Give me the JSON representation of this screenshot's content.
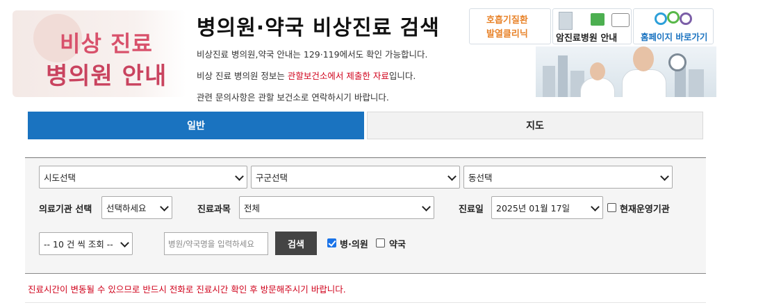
{
  "logo": {
    "line1": "비상 진료",
    "line2": "병의원 안내"
  },
  "title": "병의원·약국 비상진료 검색",
  "notices": {
    "line1": "비상진료 병의원,약국 안내는 129·119에서도 확인 가능합니다.",
    "line2_pre": "비상 진료 병의원 정보는 ",
    "line2_red": "관할보건소에서 제출한 자료",
    "line2_post": "입니다.",
    "line3": "관련 문의사항은 관할 보건소로 연락하시기 바랍니다."
  },
  "banner": {
    "tile1_line1": "호흡기질환",
    "tile1_line2": "발열클리닉",
    "tile2_label": "암진료병원 안내",
    "tile3_label": "홈페이지 바로가기"
  },
  "tabs": [
    {
      "label": "일반",
      "active": true
    },
    {
      "label": "지도",
      "active": false
    }
  ],
  "filters": {
    "sido": "시도선택",
    "gugun": "구군선택",
    "dong": "동선택",
    "institution_label": "의료기관 선택",
    "institution_value": "선택하세요",
    "dept_label": "진료과목",
    "dept_value": "전체",
    "date_label": "진료일",
    "date_value": "2025년 01월 17일",
    "open_now_label": "현재운영기관",
    "open_now_checked": false,
    "page_size": "-- 10 건 씩 조회 --",
    "name_placeholder": "병원/약국명을 입력하세요",
    "search_button": "검색",
    "hospital_label": "병·의원",
    "hospital_checked": true,
    "pharmacy_label": "약국",
    "pharmacy_checked": false
  },
  "warning": "진료시간이 변동될 수 있으므로 반드시 전화로 진료시간 확인 후 방문해주시기 바랍니다.",
  "colors": {
    "accent": "#1a73c0",
    "warning": "#d0021b",
    "logo": "#d8516b"
  }
}
